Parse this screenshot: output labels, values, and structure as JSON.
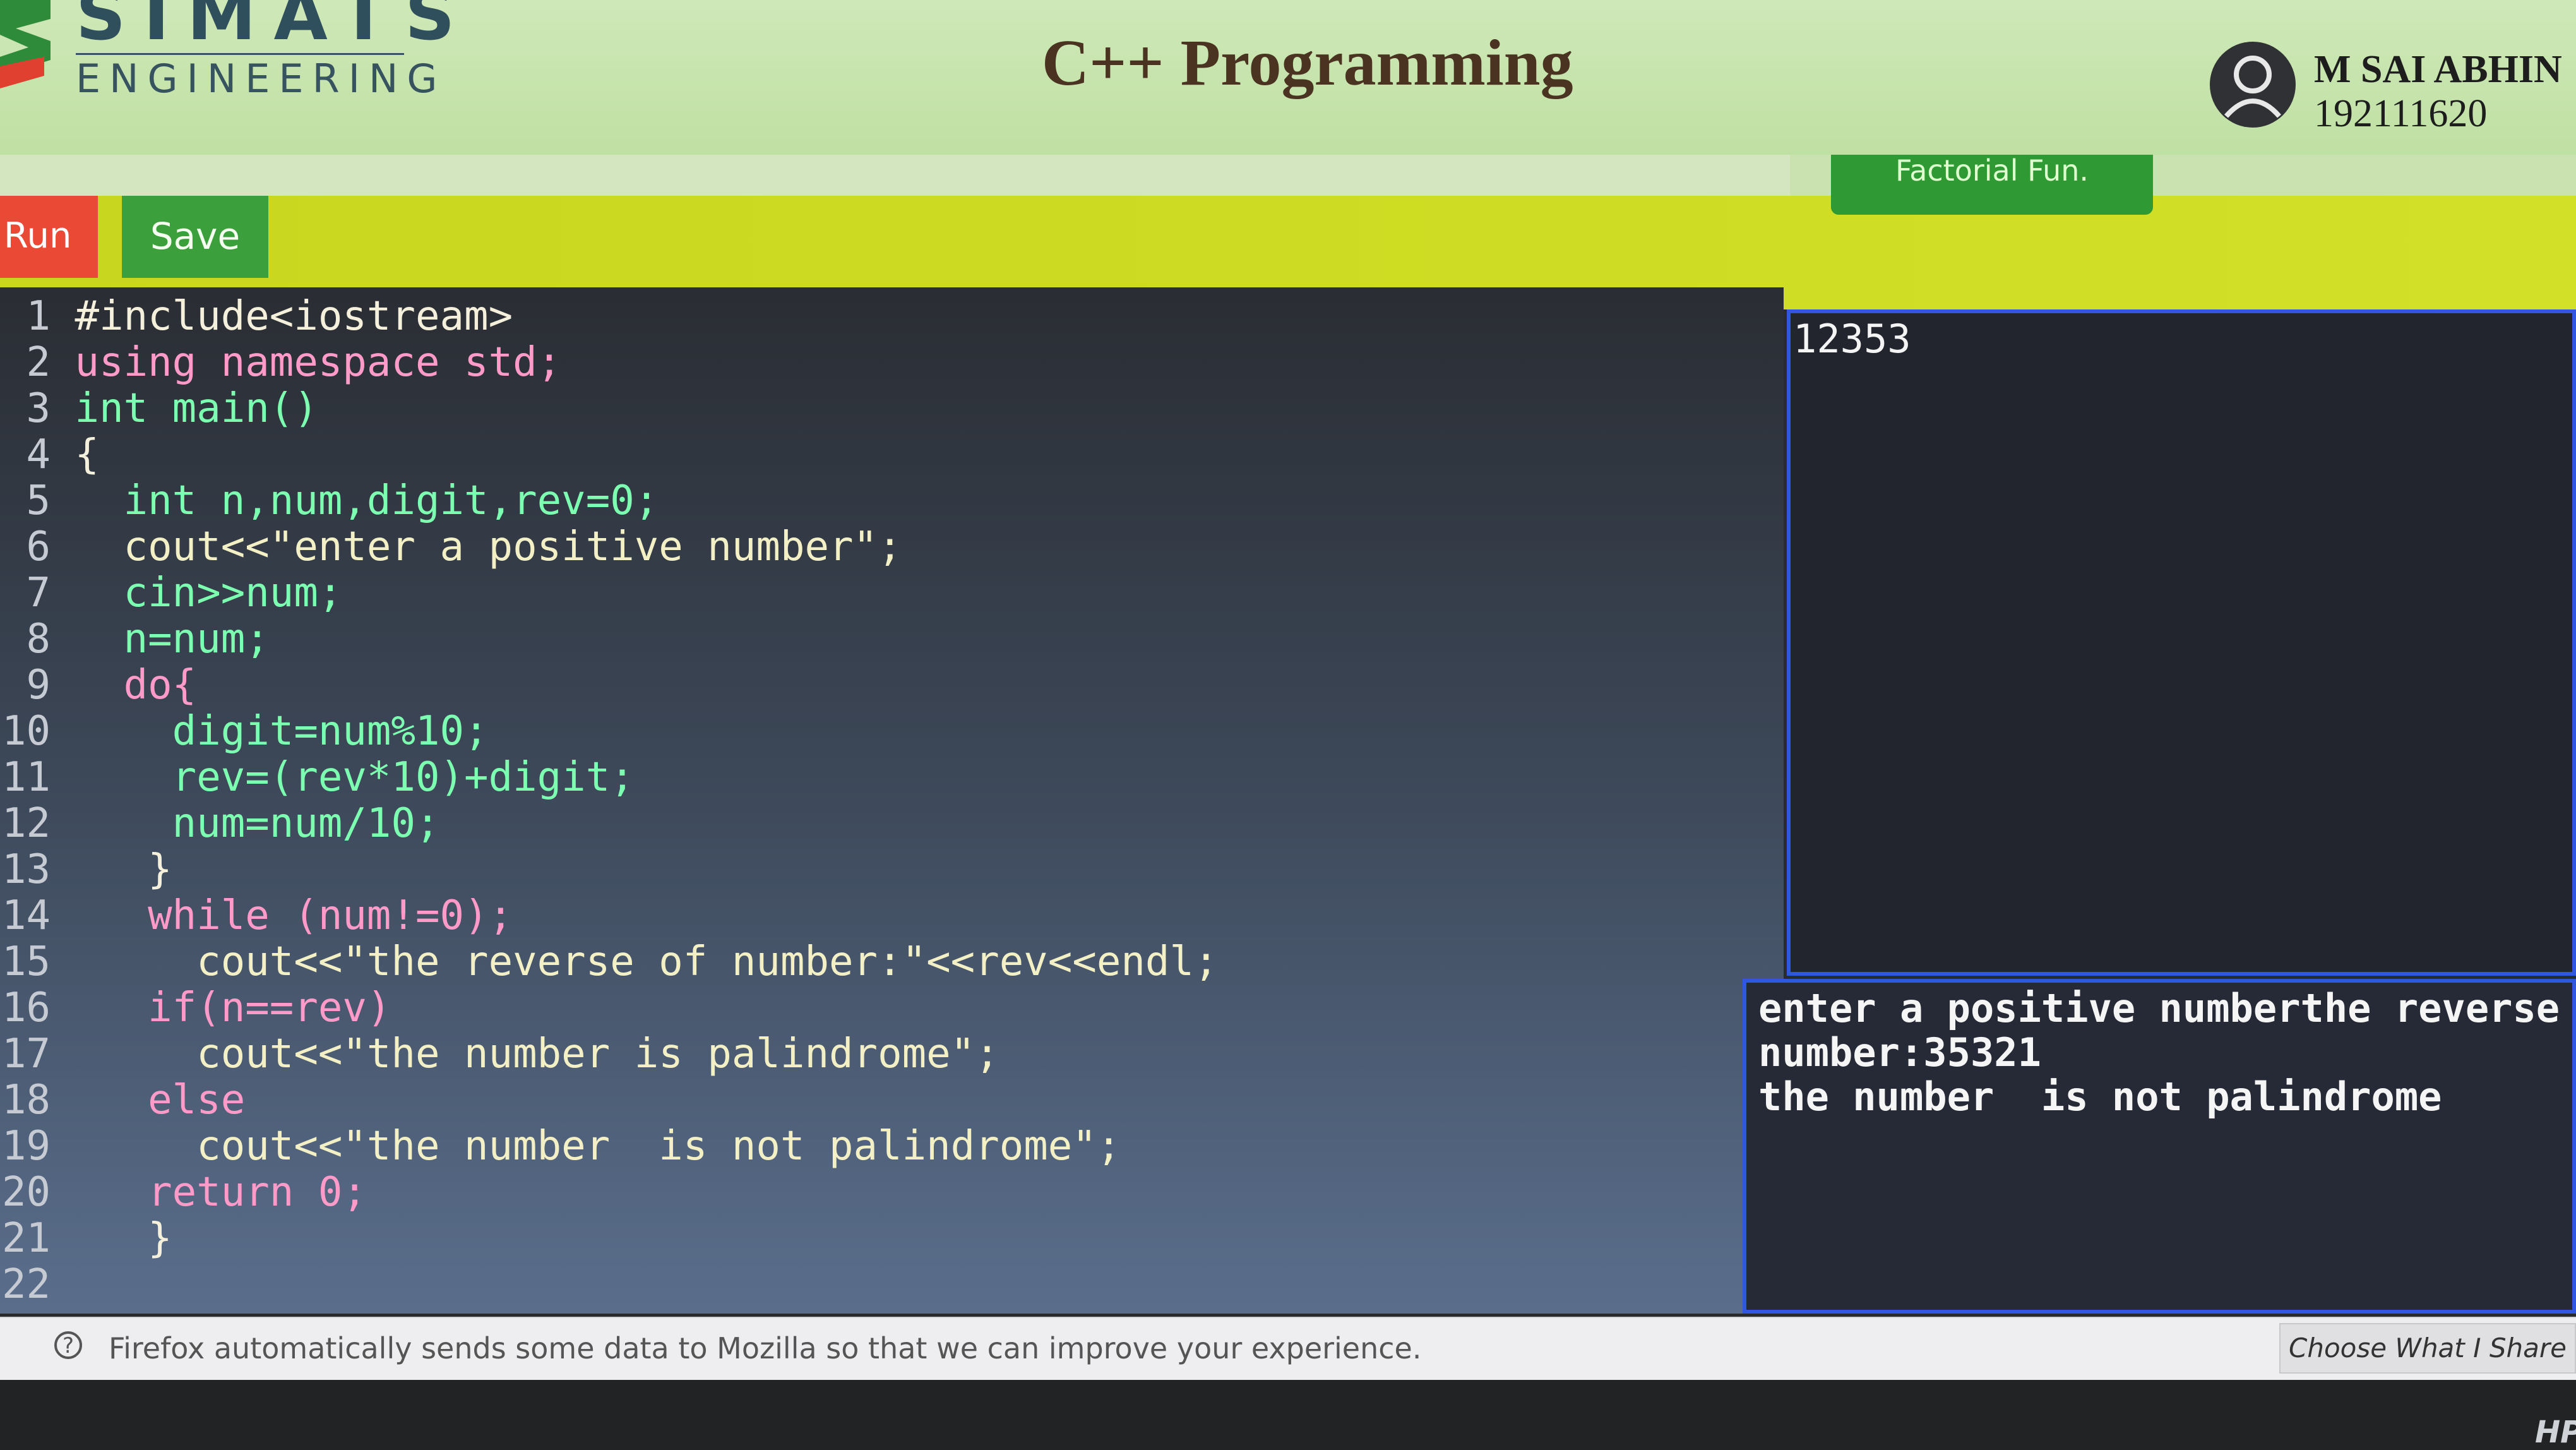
{
  "header": {
    "brand_top": "SIMATS",
    "brand_bottom": "ENGINEERING",
    "title": "C++ Programming",
    "user_name": "M SAI ABHIN",
    "user_id": "192111620"
  },
  "subbar": {
    "tab_label": "Factorial Fun."
  },
  "toolbar": {
    "run_label": "Run",
    "save_label": "Save"
  },
  "editor": {
    "lines": [
      {
        "n": "1",
        "text": "#include<iostream>"
      },
      {
        "n": "2",
        "text": "using namespace std;"
      },
      {
        "n": "3",
        "text": "int main()"
      },
      {
        "n": "4",
        "text": "{"
      },
      {
        "n": "5",
        "text": "  int n,num,digit,rev=0;"
      },
      {
        "n": "6",
        "text": "  cout<<\"enter a positive number\";"
      },
      {
        "n": "7",
        "text": "  cin>>num;"
      },
      {
        "n": "8",
        "text": "  n=num;"
      },
      {
        "n": "9",
        "text": "  do{"
      },
      {
        "n": "10",
        "text": "    digit=num%10;"
      },
      {
        "n": "11",
        "text": "    rev=(rev*10)+digit;"
      },
      {
        "n": "12",
        "text": "    num=num/10;"
      },
      {
        "n": "13",
        "text": "   }"
      },
      {
        "n": "14",
        "text": "   while (num!=0);"
      },
      {
        "n": "15",
        "text": "     cout<<\"the reverse of number:\"<<rev<<endl;"
      },
      {
        "n": "16",
        "text": "   if(n==rev)"
      },
      {
        "n": "17",
        "text": "     cout<<\"the number is palindrome\";"
      },
      {
        "n": "18",
        "text": "   else"
      },
      {
        "n": "19",
        "text": "     cout<<\"the number  is not palindrome\";"
      },
      {
        "n": "20",
        "text": "   return 0;"
      },
      {
        "n": "21",
        "text": "   }"
      },
      {
        "n": "22",
        "text": ""
      }
    ]
  },
  "input_panel": {
    "value": "12353"
  },
  "output_panel": {
    "lines": [
      "enter a positive numberthe reverse of",
      "number:35321",
      "the number  is not palindrome"
    ]
  },
  "notification": {
    "text": "Firefox automatically sends some data to Mozilla so that we can improve your experience.",
    "button_label": "Choose What I Share"
  },
  "bezel": {
    "logo_text": "HP"
  },
  "colors": {
    "header_bg": "#c8e5ae",
    "toolbar_bg": "#cddc22",
    "run_button": "#ea4936",
    "save_button": "#3b9f3b",
    "panel_border": "#2f57e0",
    "keyword": "#7dffb1",
    "title_color": "#4a3320"
  }
}
